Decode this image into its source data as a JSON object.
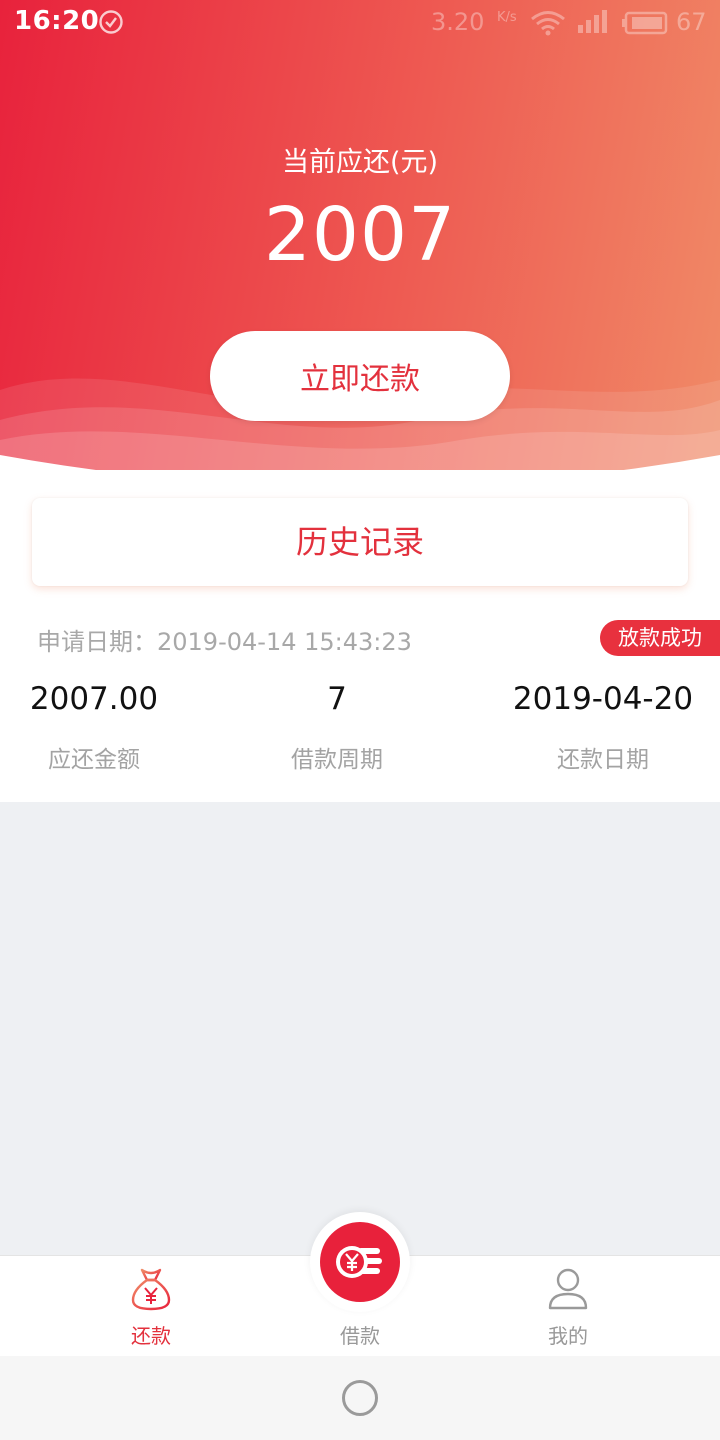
{
  "status_bar": {
    "time": "16:20",
    "speed": "3.20",
    "speed_unit": "K/s",
    "battery": "67",
    "icons": [
      "check-circle-icon",
      "wifi-icon",
      "signal-icon",
      "battery-icon"
    ]
  },
  "summary": {
    "label": "当前应还(元)",
    "amount": "2007",
    "repay_button": "立即还款"
  },
  "history": {
    "button": "历史记录",
    "record": {
      "apply_label": "申请日期：",
      "apply_date": "2019-04-14 15:43:23",
      "status": "放款成功",
      "columns": [
        {
          "value": "2007.00",
          "label": "应还金额"
        },
        {
          "value": "7",
          "label": "借款周期"
        },
        {
          "value": "2019-04-20",
          "label": "还款日期"
        }
      ]
    }
  },
  "tabbar": {
    "tabs": [
      {
        "label": "还款",
        "icon": "money-bag-icon",
        "active": true
      },
      {
        "label": "借款",
        "icon": "coin-stack-icon",
        "active": false
      },
      {
        "label": "我的",
        "icon": "user-icon",
        "active": false
      }
    ]
  },
  "colors": {
    "accent": "#e8313e",
    "gradient_start": "#e8223c",
    "gradient_end": "#f08b67",
    "active_tab": "#e3313d",
    "inactive_tab": "#999999"
  }
}
